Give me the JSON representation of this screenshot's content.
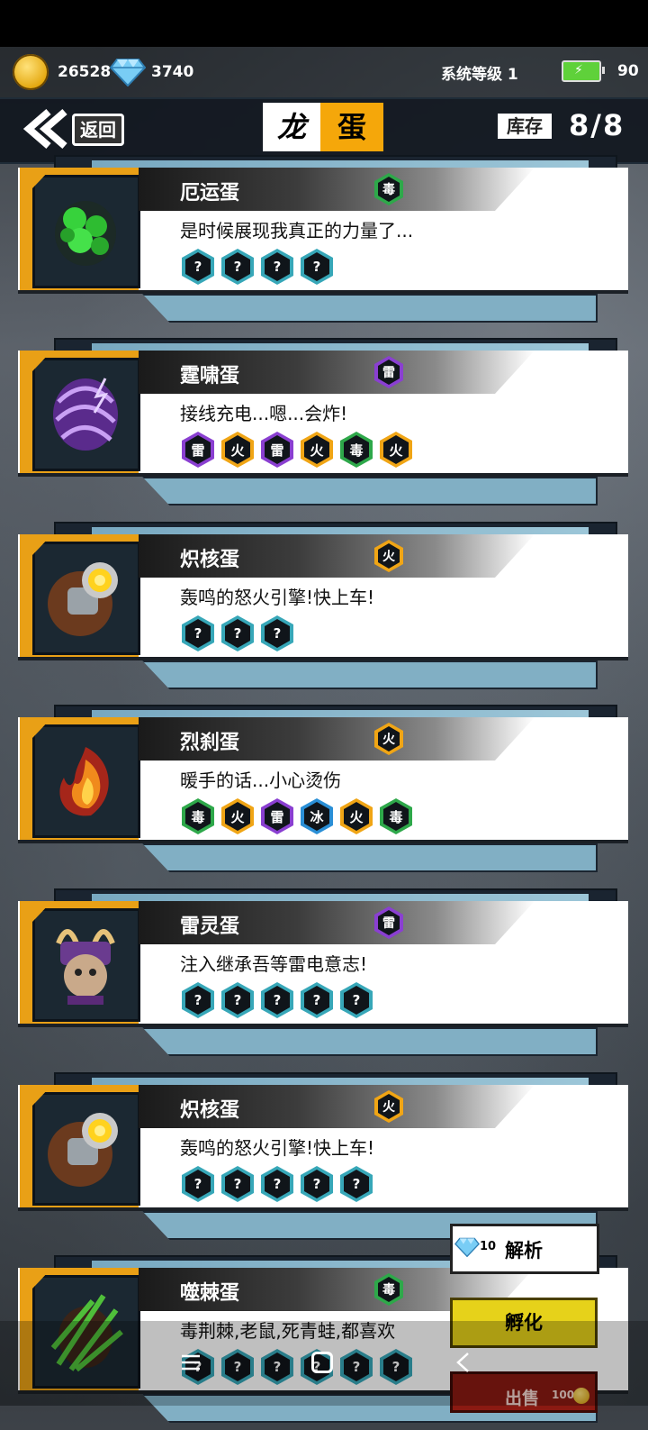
{
  "topbar": {
    "coins": "26528",
    "gems": "3740",
    "system_level": "系统等级 1",
    "battery": "90"
  },
  "header": {
    "back_label": "返回",
    "title_left": "龙",
    "title_right": "蛋",
    "stock_label": "库存",
    "stock_value": "8/8"
  },
  "eggs": [
    {
      "name": "厄运蛋",
      "type": "毒",
      "desc": "是时候展现我真正的力量了...",
      "genes": [
        "?",
        "?",
        "?",
        "?"
      ]
    },
    {
      "name": "霆啸蛋",
      "type": "雷",
      "desc": "接线充电...嗯...会炸!",
      "genes": [
        "雷",
        "火",
        "雷",
        "火",
        "毒",
        "火"
      ]
    },
    {
      "name": "炽核蛋",
      "type": "火",
      "desc": "轰鸣的怒火引擎!快上车!",
      "genes": [
        "?",
        "?",
        "?"
      ]
    },
    {
      "name": "烈刹蛋",
      "type": "火",
      "desc": "暖手的话...小心烫伤",
      "genes": [
        "毒",
        "火",
        "雷",
        "冰",
        "火",
        "毒"
      ]
    },
    {
      "name": "雷灵蛋",
      "type": "雷",
      "desc": "注入继承吾等雷电意志!",
      "genes": [
        "?",
        "?",
        "?",
        "?",
        "?"
      ]
    },
    {
      "name": "炽核蛋",
      "type": "火",
      "desc": "轰鸣的怒火引擎!快上车!",
      "genes": [
        "?",
        "?",
        "?",
        "?",
        "?"
      ]
    },
    {
      "name": "噬棘蛋",
      "type": "毒",
      "desc": "毒荆棘,老鼠,死青蛙,都喜欢",
      "genes": [
        "?",
        "?",
        "?",
        "?",
        "?",
        "?"
      ]
    }
  ],
  "buttons": {
    "analyze_cost": "10",
    "analyze": "解析",
    "hatch": "孵化",
    "sell": "出售",
    "sell_cost": "100"
  },
  "colors": {
    "毒": "#2ea84a",
    "火": "#f0a515",
    "雷": "#8a3fd1",
    "冰": "#2a8fd6",
    "?": "#37a7b8"
  }
}
